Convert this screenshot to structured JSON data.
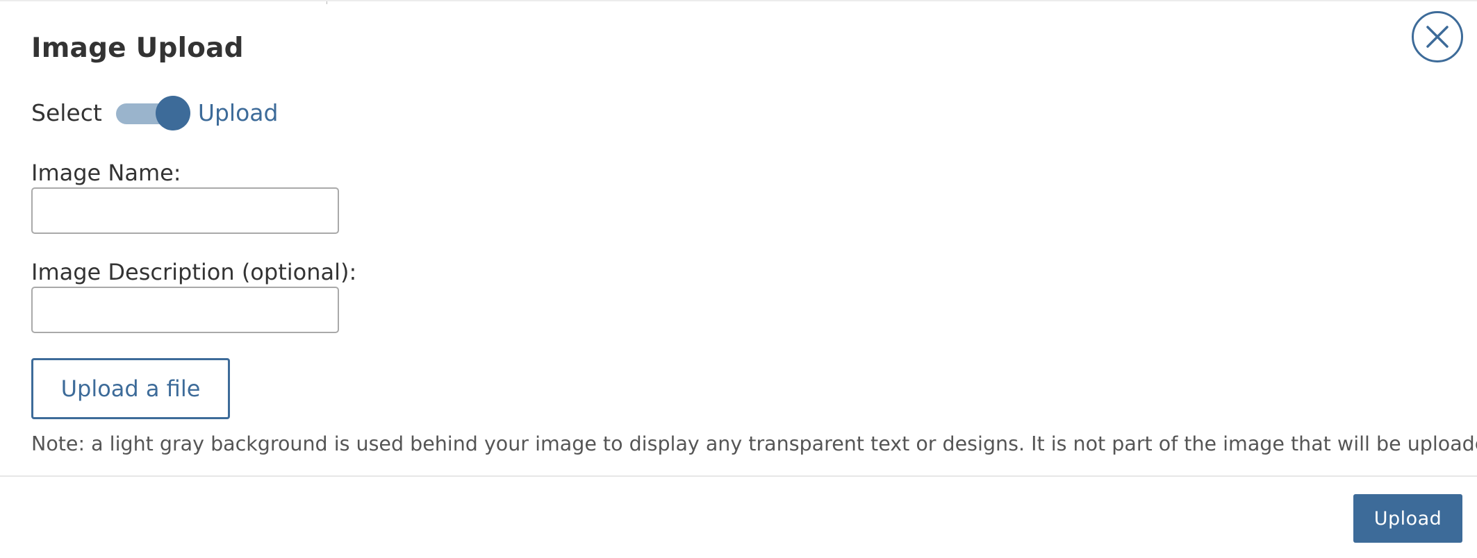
{
  "modal": {
    "title": "Image Upload",
    "close_icon": "close-icon"
  },
  "mode_toggle": {
    "left_label": "Select",
    "right_label": "Upload",
    "state": "Upload"
  },
  "fields": {
    "name": {
      "label": "Image Name:",
      "value": "",
      "placeholder": ""
    },
    "description": {
      "label": "Image Description (optional):",
      "value": "",
      "placeholder": ""
    }
  },
  "upload_file_button_label": "Upload a file",
  "note": "Note: a light gray background is used behind your image to display any transparent text or designs. It is not part of the image that will be uploaded.",
  "footer": {
    "submit_label": "Upload"
  },
  "colors": {
    "accent": "#3d6b99",
    "toggle_track": "#9ab4cc",
    "text": "#333333",
    "note_text": "#555555",
    "input_border": "#a9a9a9",
    "divider": "#e6e6e6"
  }
}
